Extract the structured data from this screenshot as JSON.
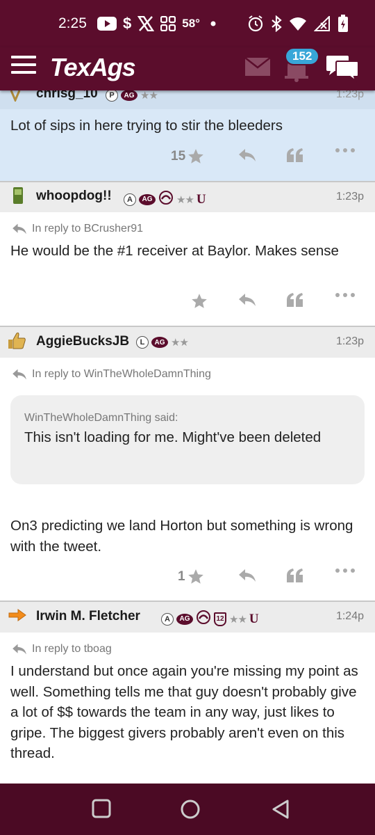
{
  "status_bar": {
    "time": "2:25",
    "temperature": "58°",
    "icons": [
      "youtube-icon",
      "dollar-icon",
      "x-icon",
      "grid-icon",
      "dot-icon",
      "alarm-icon",
      "bluetooth-icon",
      "wifi-icon",
      "signal-icon",
      "battery-icon"
    ],
    "dollar": "$"
  },
  "header": {
    "logo": "TexAgs",
    "notification_count": "152"
  },
  "posts": [
    {
      "username": "chrisg_10",
      "badges": [
        "P",
        "AG"
      ],
      "stars": "★★",
      "time": "1:23p",
      "body": "Lot of sips in here trying to stir the bleeders",
      "likes": "15"
    },
    {
      "username": "whoopdog!!",
      "badges": [
        "A",
        "AG"
      ],
      "stars": "★★",
      "u_badge": "U",
      "time": "1:23p",
      "reply_to": "In reply to BCrusher91",
      "body": "He would be the #1 receiver at Baylor. Makes sense",
      "likes": ""
    },
    {
      "username": "AggieBucksJB",
      "badges": [
        "L",
        "AG"
      ],
      "stars": "★★",
      "time": "1:23p",
      "reply_to": "In reply to WinTheWholeDamnThing",
      "quote_author": "WinTheWholeDamnThing said:",
      "quote_text": "This isn't loading for me. Might've been deleted",
      "body": "On3 predicting we land Horton but something is wrong with the tweet.",
      "likes": "1"
    },
    {
      "username": "Irwin M. Fletcher",
      "badges": [
        "A",
        "AG"
      ],
      "stars": "★★",
      "twelfth": "12",
      "u_badge": "U",
      "time": "1:24p",
      "reply_to": "In reply to tboag",
      "body": "I understand but once again you're missing my point as well. Something tells me that guy doesn't probably give a lot of $$ towards the team in any way, just likes to gripe. The biggest givers probably aren't even on this thread."
    }
  ],
  "colors": {
    "maroon": "#5b0d2c",
    "highlight": "#d9e8f7",
    "badge_blue": "#38a6d8"
  }
}
